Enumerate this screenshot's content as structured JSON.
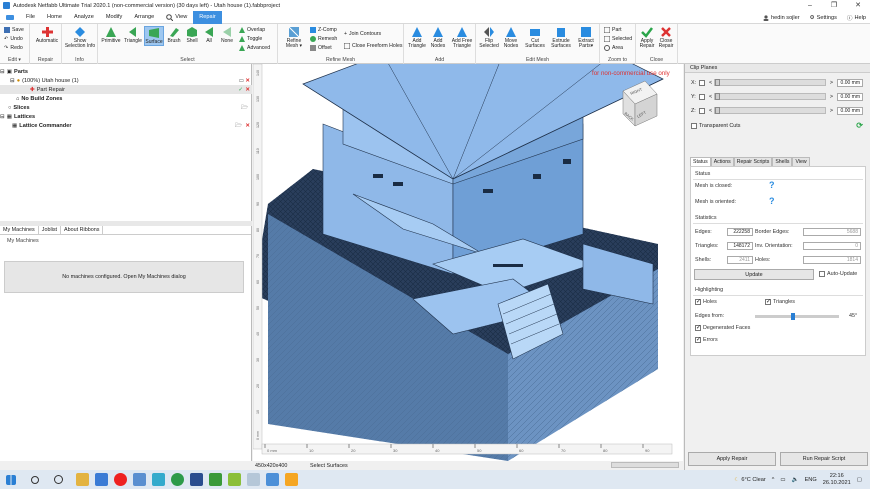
{
  "window": {
    "title": "Autodesk Netfabb Ultimate Trial 2020.1 (non-commercial version) (30 days left) - Utah house (1).fabbproject",
    "controls": [
      "–",
      "❐",
      "✕"
    ]
  },
  "menu": {
    "tabs": [
      "File",
      "Home",
      "Analyze",
      "Modify",
      "Arrange",
      "View",
      "Repair"
    ],
    "active": "Repair",
    "user": "hedin sojler",
    "settings": "Settings",
    "help": "Help"
  },
  "ribbon": {
    "edit": {
      "label": "Edit",
      "save": "Save",
      "undo": "Undo",
      "redo": "Redo"
    },
    "repair": {
      "label": "Repair",
      "automatic": "Automatic"
    },
    "info": {
      "label": "Info",
      "show_selection_info": "Show Selection Info"
    },
    "select": {
      "label": "Select",
      "buttons": [
        "Primitive",
        "Triangle",
        "Surface",
        "Brush",
        "Shell",
        "All",
        "None"
      ],
      "selected": "Surface",
      "options": [
        "Overlap",
        "Toggle",
        "Advanced"
      ]
    },
    "refine": {
      "label": "Refine Mesh",
      "refine": "Refine Mesh",
      "zcomp": "Z-Comp",
      "remesh": "Remesh",
      "offset": "Offset",
      "join_contours": "Join Contours",
      "close_freeform_holes": "Close Freeform Holes"
    },
    "add": {
      "label": "Add",
      "buttons": [
        "Add Triangle",
        "Add Nodes",
        "Add Free Triangle"
      ]
    },
    "edit_mesh": {
      "label": "Edit Mesh",
      "buttons": [
        "Flip Selected",
        "Move Nodes",
        "Cut Surfaces",
        "Extrude Surfaces",
        "Extract Parts"
      ]
    },
    "zoom": {
      "label": "Zoom to",
      "part": "Part",
      "selected": "Selected",
      "area": "Area"
    },
    "close": {
      "label": "Close",
      "apply": "Apply Repair",
      "close": "Close Repair"
    }
  },
  "tree": {
    "parts": "Parts",
    "part_name": "(100%) Utah house  (1)",
    "part_repair": "Part Repair",
    "no_build_zones": "No Build Zones",
    "slices": "Slices",
    "lattices": "Lattices",
    "lattice_commander": "Lattice Commander"
  },
  "machines": {
    "tabs": [
      "My Machines",
      "Joblist",
      "About Ribbons"
    ],
    "header": "My Machines",
    "message": "No machines configured. Open My Machines dialog"
  },
  "viewport": {
    "watermark": "for non-commercial use only",
    "cube_labels": [
      "RIGHT",
      "BACK",
      "LEFT"
    ],
    "ruler_ticks": [
      "0 mm",
      "10",
      "20",
      "30",
      "40",
      "50",
      "60",
      "70",
      "80",
      "90"
    ],
    "vruler_ticks": [
      "0 mm",
      "10",
      "20",
      "30",
      "40",
      "50",
      "60",
      "70",
      "80",
      "90",
      "100",
      "110",
      "120",
      "130",
      "140"
    ],
    "size": "450x420x400",
    "status": "Select Surfaces"
  },
  "clip": {
    "header": "Clip Planes",
    "rows": [
      {
        "axis": "X:",
        "value": "0.00 mm"
      },
      {
        "axis": "Y:",
        "value": "0.00 mm"
      },
      {
        "axis": "Z:",
        "value": "0.00 mm"
      }
    ],
    "transparent_cuts": "Transparent Cuts"
  },
  "status_panel": {
    "tabs": [
      "Status",
      "Actions",
      "Repair Scripts",
      "Shells",
      "View"
    ],
    "status_title": "Status",
    "mesh_closed": "Mesh is closed:",
    "mesh_oriented": "Mesh is oriented:",
    "q": "?",
    "statistics": "Statistics",
    "edges_label": "Edges:",
    "edges": "222258",
    "border_edges_label": "Border Edges:",
    "border_edges": "5688",
    "triangles_label": "Triangles:",
    "triangles": "148172",
    "inv_orientation_label": "Inv. Orientation:",
    "inv_orientation": "0",
    "shells_label": "Shells:",
    "shells": "2411",
    "holes_label": "Holes:",
    "holes": "1814",
    "update": "Update",
    "auto_update": "Auto-Update",
    "highlighting": "Highlighting",
    "holes_cb": "Holes",
    "triangles_cb": "Triangles",
    "edges_from": "Edges from:",
    "edges_deg": "45°",
    "edges_fraction": 0.45,
    "degenerated": "Degenerated Faces",
    "errors": "Errors"
  },
  "bottom_buttons": {
    "apply": "Apply Repair",
    "run": "Run Repair Script"
  },
  "taskbar": {
    "weather": "6°C  Clear",
    "lang": "ENG",
    "time": "22:16",
    "date": "26.10.2021"
  }
}
